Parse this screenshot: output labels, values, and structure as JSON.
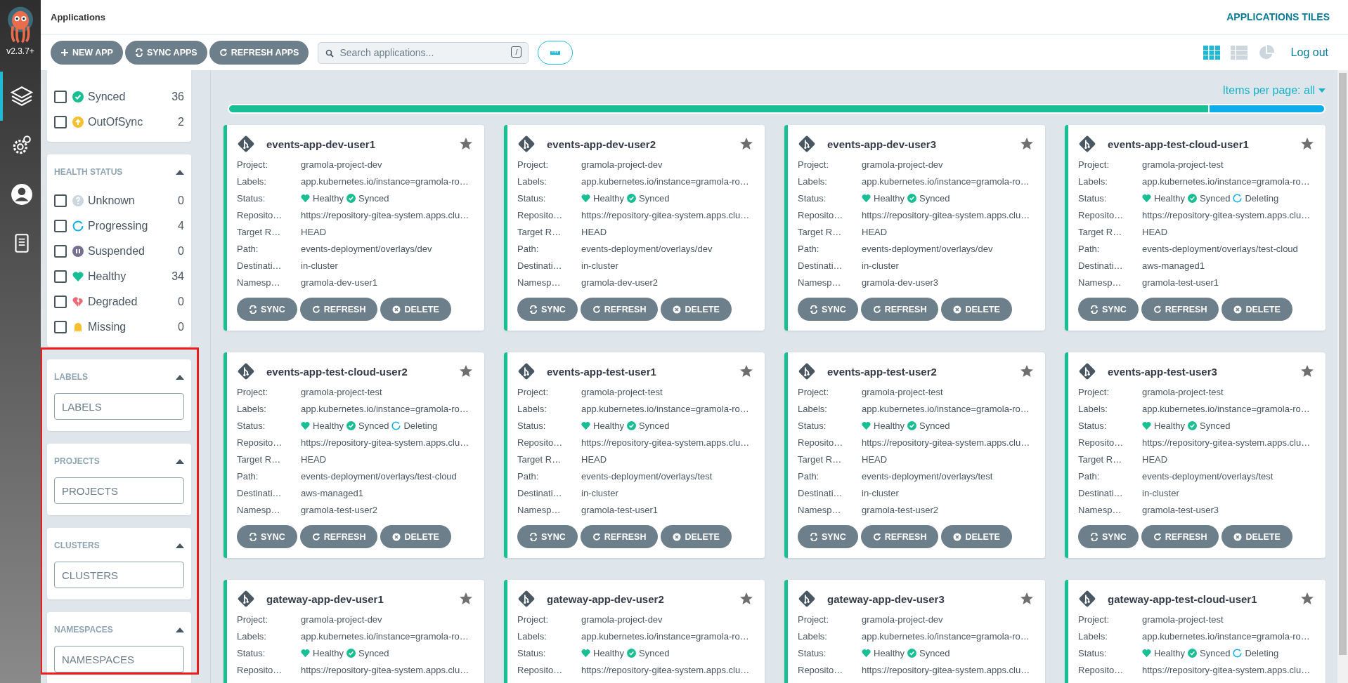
{
  "nav": {
    "version": "v2.3.7+",
    "items": [
      {
        "kind": "layers",
        "selected": true
      },
      {
        "kind": "gear",
        "selected": false
      },
      {
        "kind": "user",
        "selected": false
      },
      {
        "kind": "docs",
        "selected": false
      }
    ]
  },
  "header": {
    "breadcrumb": "Applications",
    "title": "APPLICATIONS TILES"
  },
  "toolbar": {
    "buttons": [
      {
        "kind": "plus",
        "label": "NEW APP"
      },
      {
        "kind": "sync",
        "label": "SYNC APPS"
      },
      {
        "kind": "refresh",
        "label": "REFRESH APPS"
      }
    ],
    "search": {
      "placeholder": "Search applications...",
      "shortcut": "/"
    },
    "views": [
      {
        "kind": "tiles",
        "selected": true
      },
      {
        "kind": "list",
        "selected": false
      },
      {
        "kind": "pie",
        "selected": false
      }
    ],
    "logout": "Log out"
  },
  "filters": {
    "sync_rows": [
      {
        "kind": "synced",
        "label": "Synced",
        "count": "36",
        "checked": false
      },
      {
        "kind": "outofsync",
        "label": "OutOfSync",
        "count": "2",
        "checked": false
      }
    ],
    "health": {
      "title": "HEALTH STATUS",
      "expanded": true,
      "rows": [
        {
          "kind": "unknown",
          "label": "Unknown",
          "count": "0",
          "checked": false
        },
        {
          "kind": "progressing",
          "label": "Progressing",
          "count": "4",
          "checked": false
        },
        {
          "kind": "suspended",
          "label": "Suspended",
          "count": "0",
          "checked": false
        },
        {
          "kind": "healthy",
          "label": "Healthy",
          "count": "34",
          "checked": false
        },
        {
          "kind": "degraded",
          "label": "Degraded",
          "count": "0",
          "checked": false
        },
        {
          "kind": "missing",
          "label": "Missing",
          "count": "0",
          "checked": false
        }
      ]
    },
    "inputs": [
      {
        "title": "LABELS",
        "placeholder": "LABELS",
        "expanded": true
      },
      {
        "title": "PROJECTS",
        "placeholder": "PROJECTS",
        "expanded": true
      },
      {
        "title": "CLUSTERS",
        "placeholder": "CLUSTERS",
        "expanded": true
      },
      {
        "title": "NAMESPACES",
        "placeholder": "NAMESPACES",
        "expanded": true
      }
    ]
  },
  "items_per_page": "Items per page: all",
  "status_bar": [
    {
      "level": 0.895,
      "color": "#18be94"
    },
    {
      "level": 0.105,
      "color": "#0dadea"
    }
  ],
  "apps": [
    {
      "name": "events-app-dev-user1",
      "fields": [
        {
          "kind": "text",
          "label": "Project:",
          "value": "gramola-project-dev"
        },
        {
          "kind": "text",
          "label": "Labels:",
          "value": "app.kubernetes.io/instance=gramola-ro…"
        },
        {
          "kind": "status",
          "label": "Status:",
          "badges": [
            {
              "kind": "healthy",
              "text": "Healthy"
            },
            {
              "kind": "synced",
              "text": "Synced"
            }
          ]
        },
        {
          "kind": "text",
          "label": "Reposito…",
          "value": "https://repository-gitea-system.apps.clu…"
        },
        {
          "kind": "text",
          "label": "Target R…",
          "value": "HEAD"
        },
        {
          "kind": "text",
          "label": "Path:",
          "value": "events-deployment/overlays/dev"
        },
        {
          "kind": "text",
          "label": "Destinati…",
          "value": "in-cluster"
        },
        {
          "kind": "text",
          "label": "Namesp…",
          "value": "gramola-dev-user1"
        }
      ],
      "actions": [
        {
          "kind": "sync",
          "label": "SYNC"
        },
        {
          "kind": "refresh",
          "label": "REFRESH"
        },
        {
          "kind": "delete",
          "label": "DELETE"
        }
      ]
    },
    {
      "name": "events-app-dev-user2",
      "fields": [
        {
          "kind": "text",
          "label": "Project:",
          "value": "gramola-project-dev"
        },
        {
          "kind": "text",
          "label": "Labels:",
          "value": "app.kubernetes.io/instance=gramola-ro…"
        },
        {
          "kind": "status",
          "label": "Status:",
          "badges": [
            {
              "kind": "healthy",
              "text": "Healthy"
            },
            {
              "kind": "synced",
              "text": "Synced"
            }
          ]
        },
        {
          "kind": "text",
          "label": "Reposito…",
          "value": "https://repository-gitea-system.apps.clu…"
        },
        {
          "kind": "text",
          "label": "Target R…",
          "value": "HEAD"
        },
        {
          "kind": "text",
          "label": "Path:",
          "value": "events-deployment/overlays/dev"
        },
        {
          "kind": "text",
          "label": "Destinati…",
          "value": "in-cluster"
        },
        {
          "kind": "text",
          "label": "Namesp…",
          "value": "gramola-dev-user2"
        }
      ],
      "actions": [
        {
          "kind": "sync",
          "label": "SYNC"
        },
        {
          "kind": "refresh",
          "label": "REFRESH"
        },
        {
          "kind": "delete",
          "label": "DELETE"
        }
      ]
    },
    {
      "name": "events-app-dev-user3",
      "fields": [
        {
          "kind": "text",
          "label": "Project:",
          "value": "gramola-project-dev"
        },
        {
          "kind": "text",
          "label": "Labels:",
          "value": "app.kubernetes.io/instance=gramola-ro…"
        },
        {
          "kind": "status",
          "label": "Status:",
          "badges": [
            {
              "kind": "healthy",
              "text": "Healthy"
            },
            {
              "kind": "synced",
              "text": "Synced"
            }
          ]
        },
        {
          "kind": "text",
          "label": "Reposito…",
          "value": "https://repository-gitea-system.apps.clu…"
        },
        {
          "kind": "text",
          "label": "Target R…",
          "value": "HEAD"
        },
        {
          "kind": "text",
          "label": "Path:",
          "value": "events-deployment/overlays/dev"
        },
        {
          "kind": "text",
          "label": "Destinati…",
          "value": "in-cluster"
        },
        {
          "kind": "text",
          "label": "Namesp…",
          "value": "gramola-dev-user3"
        }
      ],
      "actions": [
        {
          "kind": "sync",
          "label": "SYNC"
        },
        {
          "kind": "refresh",
          "label": "REFRESH"
        },
        {
          "kind": "delete",
          "label": "DELETE"
        }
      ]
    },
    {
      "name": "events-app-test-cloud-user1",
      "fields": [
        {
          "kind": "text",
          "label": "Project:",
          "value": "gramola-project-test"
        },
        {
          "kind": "text",
          "label": "Labels:",
          "value": "app.kubernetes.io/instance=gramola-ro…"
        },
        {
          "kind": "status",
          "label": "Status:",
          "badges": [
            {
              "kind": "healthy",
              "text": "Healthy"
            },
            {
              "kind": "synced",
              "text": "Synced"
            },
            {
              "kind": "deleting",
              "text": "Deleting"
            }
          ]
        },
        {
          "kind": "text",
          "label": "Reposito…",
          "value": "https://repository-gitea-system.apps.clu…"
        },
        {
          "kind": "text",
          "label": "Target R…",
          "value": "HEAD"
        },
        {
          "kind": "text",
          "label": "Path:",
          "value": "events-deployment/overlays/test-cloud"
        },
        {
          "kind": "text",
          "label": "Destinati…",
          "value": "aws-managed1"
        },
        {
          "kind": "text",
          "label": "Namesp…",
          "value": "gramola-test-user1"
        }
      ],
      "actions": [
        {
          "kind": "sync",
          "label": "SYNC"
        },
        {
          "kind": "refresh",
          "label": "REFRESH"
        },
        {
          "kind": "delete",
          "label": "DELETE"
        }
      ]
    },
    {
      "name": "events-app-test-cloud-user2",
      "fields": [
        {
          "kind": "text",
          "label": "Project:",
          "value": "gramola-project-test"
        },
        {
          "kind": "text",
          "label": "Labels:",
          "value": "app.kubernetes.io/instance=gramola-ro…"
        },
        {
          "kind": "status",
          "label": "Status:",
          "badges": [
            {
              "kind": "healthy",
              "text": "Healthy"
            },
            {
              "kind": "synced",
              "text": "Synced"
            },
            {
              "kind": "deleting",
              "text": "Deleting"
            }
          ]
        },
        {
          "kind": "text",
          "label": "Reposito…",
          "value": "https://repository-gitea-system.apps.clu…"
        },
        {
          "kind": "text",
          "label": "Target R…",
          "value": "HEAD"
        },
        {
          "kind": "text",
          "label": "Path:",
          "value": "events-deployment/overlays/test-cloud"
        },
        {
          "kind": "text",
          "label": "Destinati…",
          "value": "aws-managed1"
        },
        {
          "kind": "text",
          "label": "Namesp…",
          "value": "gramola-test-user2"
        }
      ],
      "actions": [
        {
          "kind": "sync",
          "label": "SYNC"
        },
        {
          "kind": "refresh",
          "label": "REFRESH"
        },
        {
          "kind": "delete",
          "label": "DELETE"
        }
      ]
    },
    {
      "name": "events-app-test-user1",
      "fields": [
        {
          "kind": "text",
          "label": "Project:",
          "value": "gramola-project-test"
        },
        {
          "kind": "text",
          "label": "Labels:",
          "value": "app.kubernetes.io/instance=gramola-ro…"
        },
        {
          "kind": "status",
          "label": "Status:",
          "badges": [
            {
              "kind": "healthy",
              "text": "Healthy"
            },
            {
              "kind": "synced",
              "text": "Synced"
            }
          ]
        },
        {
          "kind": "text",
          "label": "Reposito…",
          "value": "https://repository-gitea-system.apps.clu…"
        },
        {
          "kind": "text",
          "label": "Target R…",
          "value": "HEAD"
        },
        {
          "kind": "text",
          "label": "Path:",
          "value": "events-deployment/overlays/test"
        },
        {
          "kind": "text",
          "label": "Destinati…",
          "value": "in-cluster"
        },
        {
          "kind": "text",
          "label": "Namesp…",
          "value": "gramola-test-user1"
        }
      ],
      "actions": [
        {
          "kind": "sync",
          "label": "SYNC"
        },
        {
          "kind": "refresh",
          "label": "REFRESH"
        },
        {
          "kind": "delete",
          "label": "DELETE"
        }
      ]
    },
    {
      "name": "events-app-test-user2",
      "fields": [
        {
          "kind": "text",
          "label": "Project:",
          "value": "gramola-project-test"
        },
        {
          "kind": "text",
          "label": "Labels:",
          "value": "app.kubernetes.io/instance=gramola-ro…"
        },
        {
          "kind": "status",
          "label": "Status:",
          "badges": [
            {
              "kind": "healthy",
              "text": "Healthy"
            },
            {
              "kind": "synced",
              "text": "Synced"
            }
          ]
        },
        {
          "kind": "text",
          "label": "Reposito…",
          "value": "https://repository-gitea-system.apps.clu…"
        },
        {
          "kind": "text",
          "label": "Target R…",
          "value": "HEAD"
        },
        {
          "kind": "text",
          "label": "Path:",
          "value": "events-deployment/overlays/test"
        },
        {
          "kind": "text",
          "label": "Destinati…",
          "value": "in-cluster"
        },
        {
          "kind": "text",
          "label": "Namesp…",
          "value": "gramola-test-user2"
        }
      ],
      "actions": [
        {
          "kind": "sync",
          "label": "SYNC"
        },
        {
          "kind": "refresh",
          "label": "REFRESH"
        },
        {
          "kind": "delete",
          "label": "DELETE"
        }
      ]
    },
    {
      "name": "events-app-test-user3",
      "fields": [
        {
          "kind": "text",
          "label": "Project:",
          "value": "gramola-project-test"
        },
        {
          "kind": "text",
          "label": "Labels:",
          "value": "app.kubernetes.io/instance=gramola-ro…"
        },
        {
          "kind": "status",
          "label": "Status:",
          "badges": [
            {
              "kind": "healthy",
              "text": "Healthy"
            },
            {
              "kind": "synced",
              "text": "Synced"
            }
          ]
        },
        {
          "kind": "text",
          "label": "Reposito…",
          "value": "https://repository-gitea-system.apps.clu…"
        },
        {
          "kind": "text",
          "label": "Target R…",
          "value": "HEAD"
        },
        {
          "kind": "text",
          "label": "Path:",
          "value": "events-deployment/overlays/test"
        },
        {
          "kind": "text",
          "label": "Destinati…",
          "value": "in-cluster"
        },
        {
          "kind": "text",
          "label": "Namesp…",
          "value": "gramola-test-user3"
        }
      ],
      "actions": [
        {
          "kind": "sync",
          "label": "SYNC"
        },
        {
          "kind": "refresh",
          "label": "REFRESH"
        },
        {
          "kind": "delete",
          "label": "DELETE"
        }
      ]
    },
    {
      "name": "gateway-app-dev-user1",
      "fields": [
        {
          "kind": "text",
          "label": "Project:",
          "value": "gramola-project-dev"
        },
        {
          "kind": "text",
          "label": "Labels:",
          "value": "app.kubernetes.io/instance=gramola-ro…"
        },
        {
          "kind": "status",
          "label": "Status:",
          "badges": [
            {
              "kind": "healthy",
              "text": "Healthy"
            },
            {
              "kind": "synced",
              "text": "Synced"
            }
          ]
        },
        {
          "kind": "text",
          "label": "Reposito…",
          "value": "https://repository-gitea-system.apps.clu…"
        }
      ]
    },
    {
      "name": "gateway-app-dev-user2",
      "fields": [
        {
          "kind": "text",
          "label": "Project:",
          "value": "gramola-project-dev"
        },
        {
          "kind": "text",
          "label": "Labels:",
          "value": "app.kubernetes.io/instance=gramola-ro…"
        },
        {
          "kind": "status",
          "label": "Status:",
          "badges": [
            {
              "kind": "healthy",
              "text": "Healthy"
            },
            {
              "kind": "synced",
              "text": "Synced"
            }
          ]
        },
        {
          "kind": "text",
          "label": "Reposito…",
          "value": "https://repository-gitea-system.apps.clu…"
        }
      ]
    },
    {
      "name": "gateway-app-dev-user3",
      "fields": [
        {
          "kind": "text",
          "label": "Project:",
          "value": "gramola-project-dev"
        },
        {
          "kind": "text",
          "label": "Labels:",
          "value": "app.kubernetes.io/instance=gramola-ro…"
        },
        {
          "kind": "status",
          "label": "Status:",
          "badges": [
            {
              "kind": "healthy",
              "text": "Healthy"
            },
            {
              "kind": "synced",
              "text": "Synced"
            }
          ]
        },
        {
          "kind": "text",
          "label": "Reposito…",
          "value": "https://repository-gitea-system.apps.clu…"
        }
      ]
    },
    {
      "name": "gateway-app-test-cloud-user1",
      "fields": [
        {
          "kind": "text",
          "label": "Project:",
          "value": "gramola-project-test"
        },
        {
          "kind": "text",
          "label": "Labels:",
          "value": "app.kubernetes.io/instance=gramola-ro…"
        },
        {
          "kind": "status",
          "label": "Status:",
          "badges": [
            {
              "kind": "healthy",
              "text": "Healthy"
            },
            {
              "kind": "synced",
              "text": "Synced"
            },
            {
              "kind": "deleting",
              "text": "Deleting"
            }
          ]
        },
        {
          "kind": "text",
          "label": "Reposito…",
          "value": "https://repository-gitea-system.apps.clu…"
        }
      ]
    }
  ]
}
